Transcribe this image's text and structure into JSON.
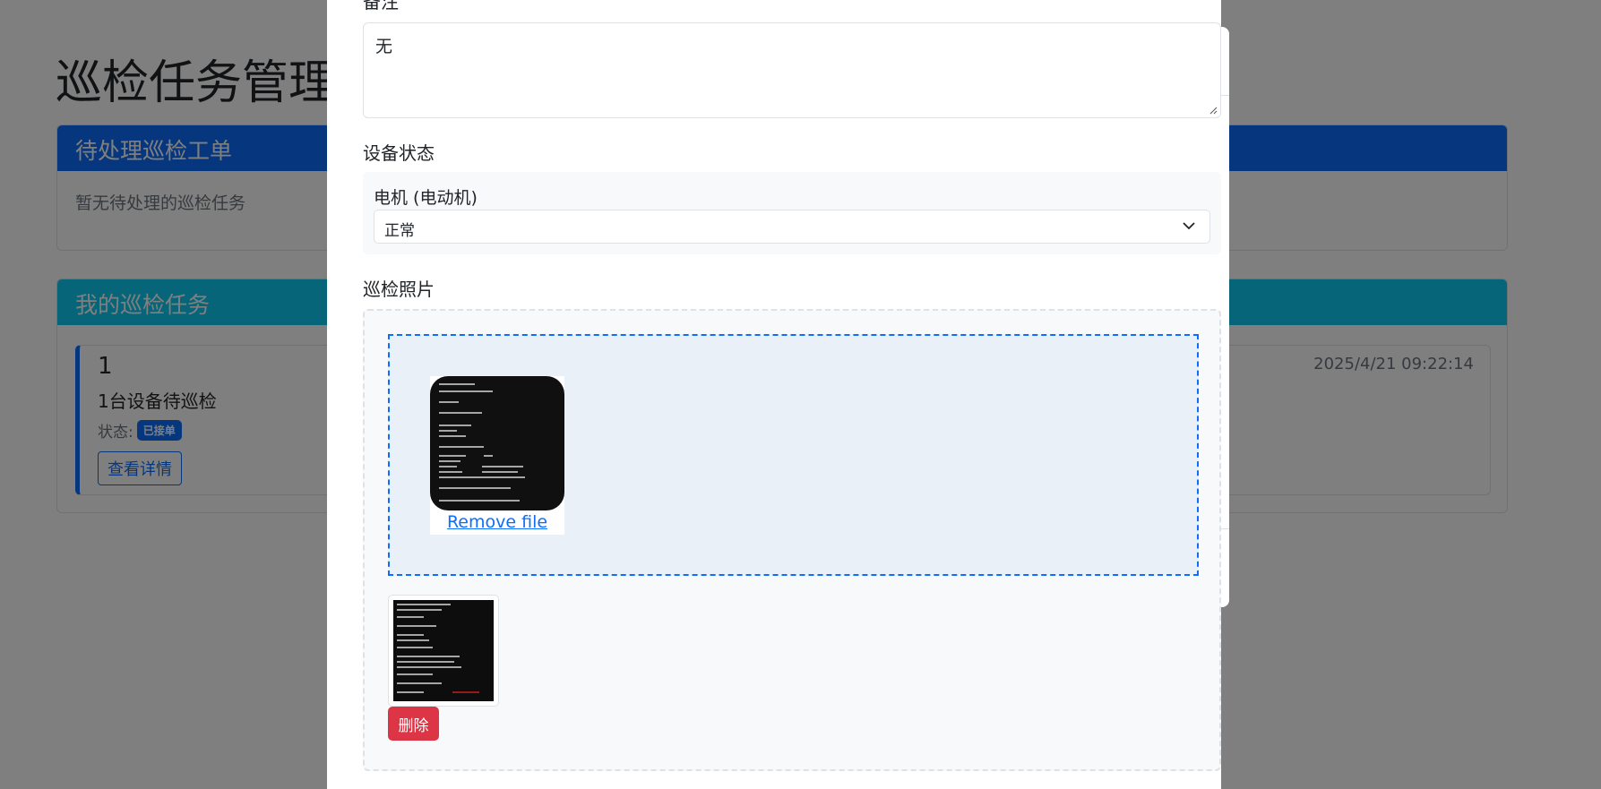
{
  "page": {
    "title": "巡检任务管理",
    "pending_card": {
      "header": "待处理巡检工单",
      "empty_text": "暂无待处理的巡检任务"
    },
    "my_tasks_card": {
      "header": "我的巡检任务",
      "tasks": [
        {
          "number": "1",
          "description": "1台设备待巡检",
          "status_label": "状态:",
          "status_badge": "已接单",
          "view_button": "查看详情",
          "timestamp": "2025/4/21 09:22:14"
        }
      ]
    }
  },
  "modal": {
    "remarks_label": "备注",
    "remarks_value": "无",
    "device_status_label": "设备状态",
    "devices": [
      {
        "name": "电机 (电动机)",
        "status": "正常"
      }
    ],
    "photos_label": "巡检照片",
    "dropzone": {
      "remove_label": "Remove file"
    },
    "uploaded": {
      "delete_label": "删除"
    }
  },
  "colors": {
    "primary": "#0d6efd",
    "info": "#0dcaf0",
    "danger": "#dc3545",
    "backdrop": "rgba(0,0,0,0.5)"
  }
}
